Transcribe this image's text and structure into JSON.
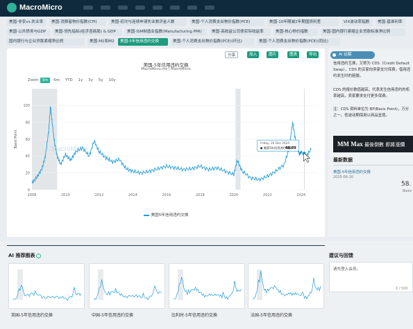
{
  "app": {
    "logo_text": "MacroMicro"
  },
  "tags": [
    {
      "label": "美国-非农vs.失业率",
      "active": false
    },
    {
      "label": "美国-消费者物价指数(CPI)",
      "active": false
    },
    {
      "label": "美国-初次与连续申请失业救济金人数",
      "active": false
    },
    {
      "label": "美国-个人消费支出物价指数(PCE)",
      "active": false
    },
    {
      "label": "美国-10年期减2年期国债利差",
      "active": false
    },
    {
      "label": "VIX波动率指数",
      "active": false
    },
    {
      "label": "美国-基准利率",
      "active": false
    },
    {
      "label": "美国-公共债务与GDP",
      "active": false
    },
    {
      "label": "美国-领先指标(经济咨商局) & GDP",
      "active": false
    },
    {
      "label": "美国-ISM制造业指数(Manufacturing PMI)",
      "active": false
    },
    {
      "label": "美国-高收益公司债实际收益率",
      "active": false
    },
    {
      "label": "美国-核心物价指数",
      "active": false
    },
    {
      "label": "美国-国内银行紧缩企业贷款标准净比例",
      "active": false
    },
    {
      "label": "国内银行与企业贷款紧缩净比例",
      "active": false
    },
    {
      "label": "美国-M1和M2",
      "active": false
    },
    {
      "label": "美国-5年信用违约交换",
      "active": true
    },
    {
      "label": "美国-个人消费支出物价指数(PCE)(环比)",
      "active": false
    },
    {
      "label": "美国-个人消费支出物价指数(PCE)(同比)",
      "active": false
    }
  ],
  "toolbar": {
    "share": "分享",
    "add": "加入",
    "image": "图片",
    "table": "图表",
    "export": "导出"
  },
  "chart": {
    "title": "美国-5年信用违约交换",
    "subtitle": "MacroMicro.me | MacroMicro",
    "zoom_label": "Zoom",
    "zoom_options": [
      "3m",
      "6m",
      "YTD",
      "1y",
      "3y",
      "5y",
      "10y"
    ],
    "zoom_active": "3m",
    "watermark": "MacroMicro",
    "legend": "美国5年信用违约交换"
  },
  "chart_data": {
    "type": "line",
    "title": "美国-5年信用违约交换",
    "ylabel": "Basis Point",
    "ylim": [
      0,
      120
    ],
    "yticks": [
      0,
      20,
      40,
      60,
      80,
      100
    ],
    "xticks": [
      "2008",
      "2010",
      "2012",
      "2014",
      "2016",
      "2018",
      "2020",
      "2022",
      "2024"
    ],
    "shaded_periods": [
      [
        2008.0,
        2009.5
      ],
      [
        2020.1,
        2020.4
      ]
    ],
    "series": [
      {
        "name": "美国5年信用违约交换",
        "color": "#1f9bd7",
        "x": [
          2008.0,
          2008.3,
          2008.6,
          2008.8,
          2009.0,
          2009.1,
          2009.2,
          2009.35,
          2009.5,
          2009.7,
          2010.0,
          2010.3,
          2010.6,
          2011.0,
          2011.4,
          2011.7,
          2012.0,
          2012.4,
          2012.8,
          2013.2,
          2013.6,
          2014.0,
          2014.5,
          2015.0,
          2015.5,
          2016.0,
          2016.5,
          2017.0,
          2017.5,
          2018.0,
          2018.5,
          2019.0,
          2019.5,
          2020.0,
          2020.2,
          2020.5,
          2021.0,
          2021.5,
          2022.0,
          2022.5,
          2023.0,
          2023.3,
          2023.5,
          2023.7,
          2023.9,
          2024.0,
          2024.3,
          2024.6
        ],
        "values": [
          8,
          15,
          25,
          40,
          70,
          100,
          80,
          55,
          40,
          30,
          42,
          35,
          45,
          50,
          40,
          58,
          45,
          38,
          33,
          36,
          25,
          22,
          20,
          22,
          25,
          28,
          26,
          24,
          25,
          28,
          24,
          26,
          22,
          18,
          35,
          22,
          14,
          12,
          16,
          22,
          30,
          50,
          80,
          55,
          42,
          45,
          40,
          48
        ]
      }
    ],
    "tooltip": {
      "date": "Friday, 20 Dec 2024",
      "series": "美国5年信用违约交换",
      "value": "48.89"
    }
  },
  "ai_panel": {
    "header": "AI 註解",
    "para1": "信用违约互换，又称为 CDS（Credit Default Swap），CDS 的买家向卖家支付保费，借用违约发生时的赔偿。",
    "para2": "CDS 的报价数值越高，代表发生信用违约的机率越高，卖家要求支付更多保费。",
    "para3": "注：CDS 资料单位为 BP(Basis Point)，万分之一。低波动期保用以商品呈现。"
  },
  "banner": {
    "brand": "MM Max",
    "text": "最後倒數 即將漲價"
  },
  "latest": {
    "title": "最新数据",
    "name": "美国-5年信用违约交换",
    "date": "2025-06-16",
    "value": "58.",
    "unit": "Basis"
  },
  "recommend": {
    "title": "AI 推荐图表",
    "items": [
      {
        "label": "英国-5年信用违约交换"
      },
      {
        "label": "中国-5年信用违约交换"
      },
      {
        "label": "比利时-5年信用违约交换"
      },
      {
        "label": "法国-5年信用违约交换"
      }
    ]
  },
  "feedback": {
    "title": "建议与回馈",
    "hint": "请先登入会员。",
    "count": "0 / 500"
  }
}
